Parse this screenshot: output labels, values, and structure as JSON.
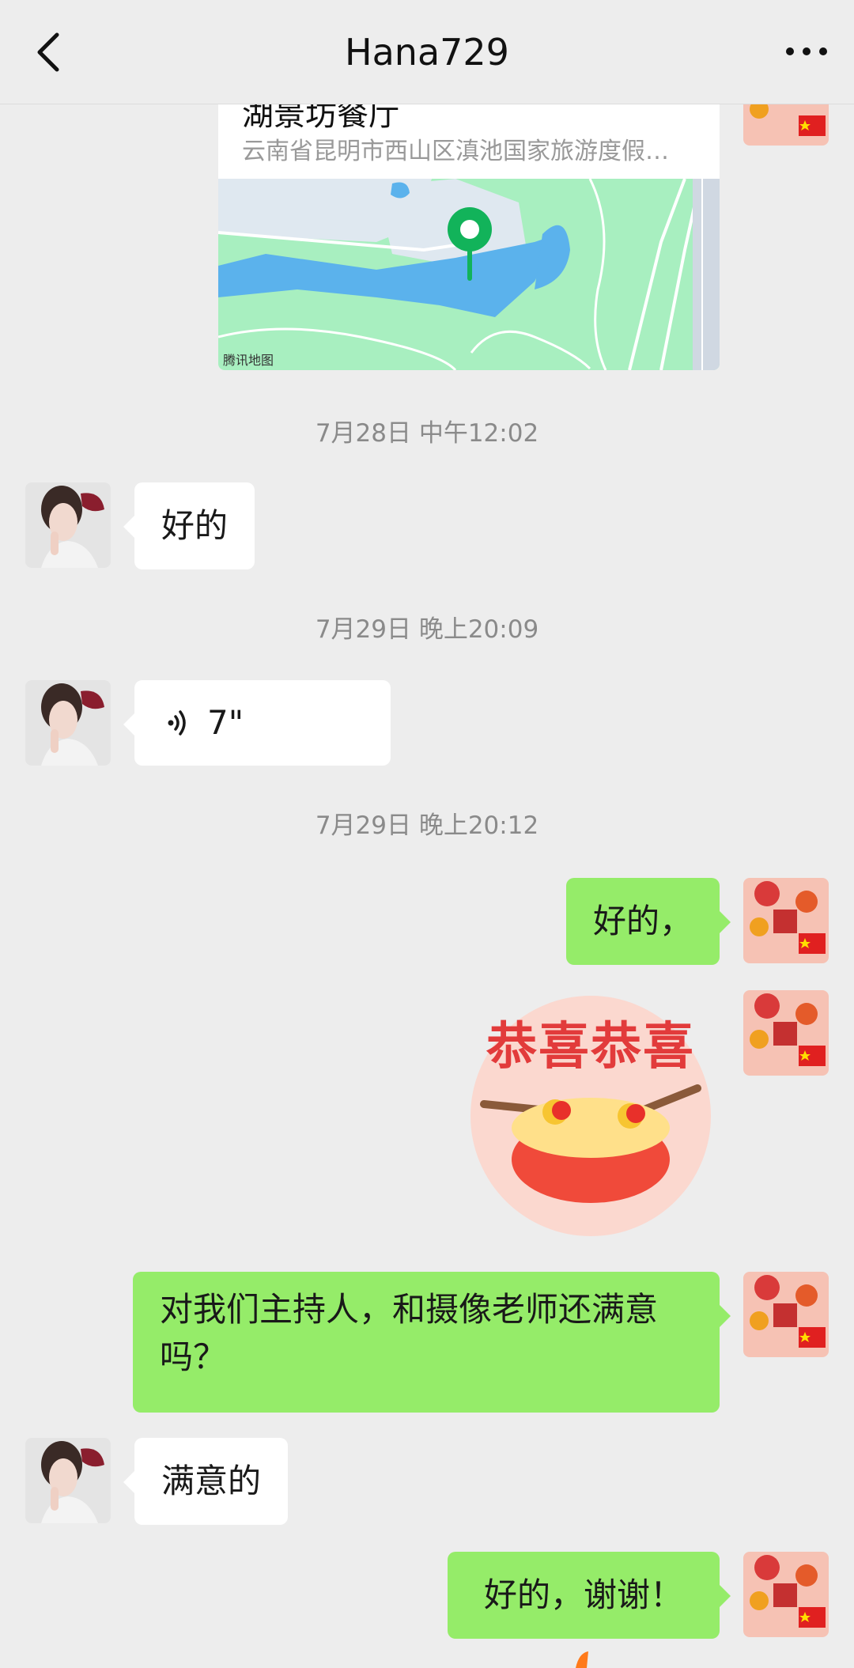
{
  "header": {
    "title": "Hana729"
  },
  "location": {
    "name": "湖景坊餐厅",
    "address": "云南省昆明市西山区滇池国家旅游度假…",
    "map_brand": "腾讯地图"
  },
  "timestamps": [
    "7月28日 中午12:02",
    "7月29日 晚上20:09",
    "7月29日 晚上20:12"
  ],
  "messages": {
    "m1": "好的",
    "voice_duration": "7\"",
    "m3": "好的，",
    "sticker_text": "恭喜恭喜",
    "m4": "对我们主持人，和摄像老师还满意吗？",
    "m5": "满意的",
    "m6": "好的，谢谢！"
  }
}
